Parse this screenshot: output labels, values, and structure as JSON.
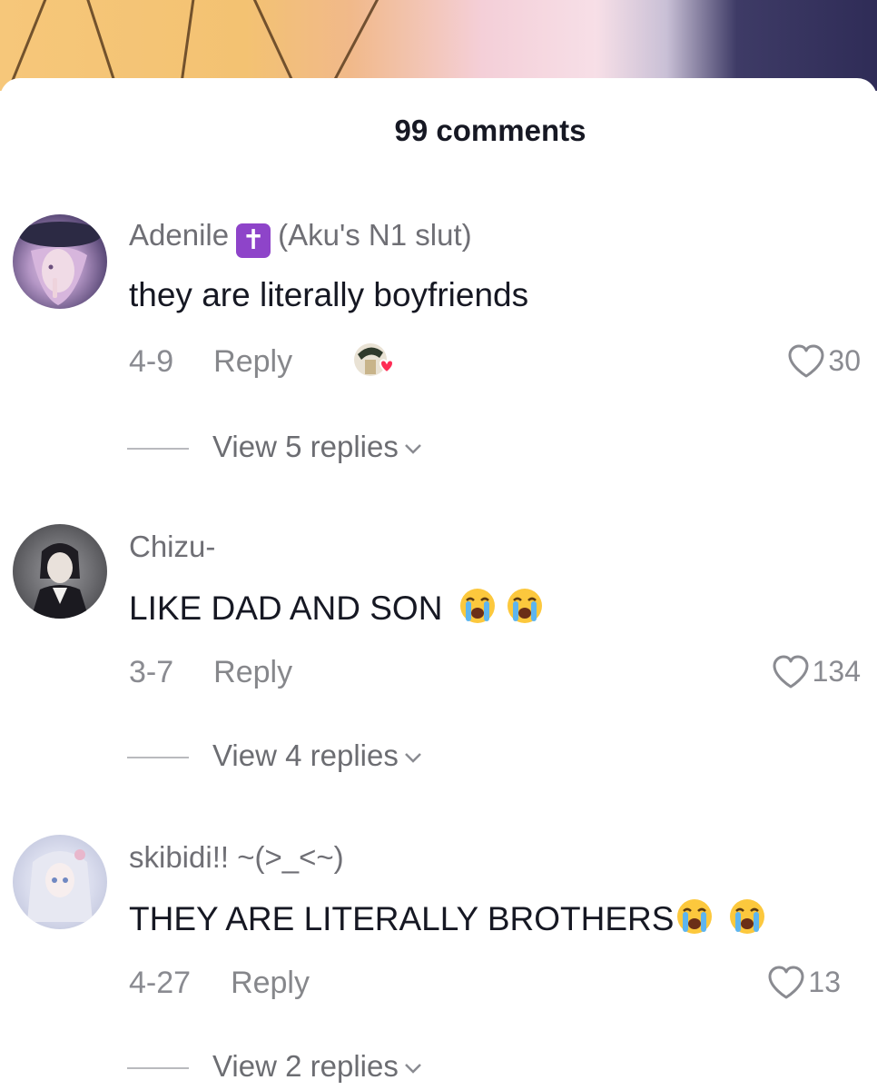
{
  "sheet": {
    "title": "99 comments"
  },
  "comments": [
    {
      "username": "Adenile",
      "badge_icon": "latin-cross-icon",
      "badge_glyph": "✝",
      "username_suffix": "(Aku's N1 slut)",
      "text": "they are literally boyfriends",
      "date": "4-9",
      "reply_label": "Reply",
      "liked_by_creator": true,
      "likes": "30",
      "view_replies": "View 5 replies"
    },
    {
      "username": "Chizu-",
      "text": "LIKE DAD AND SON",
      "text_emojis": [
        "loudly-crying-face",
        "loudly-crying-face"
      ],
      "date": "3-7",
      "reply_label": "Reply",
      "likes": "134",
      "view_replies": "View 4 replies"
    },
    {
      "username": "skibidi!! ~(>_<~)",
      "text": "THEY ARE LITERALLY BROTHERS",
      "text_emojis": [
        "loudly-crying-face",
        "loudly-crying-face"
      ],
      "date": "4-27",
      "reply_label": "Reply",
      "likes": "13",
      "view_replies": "View 2 replies"
    }
  ],
  "colors": {
    "text_primary": "#161823",
    "text_secondary": "#8a8b91",
    "badge_purple": "#8e44c9",
    "heart_red": "#fe2c55"
  }
}
